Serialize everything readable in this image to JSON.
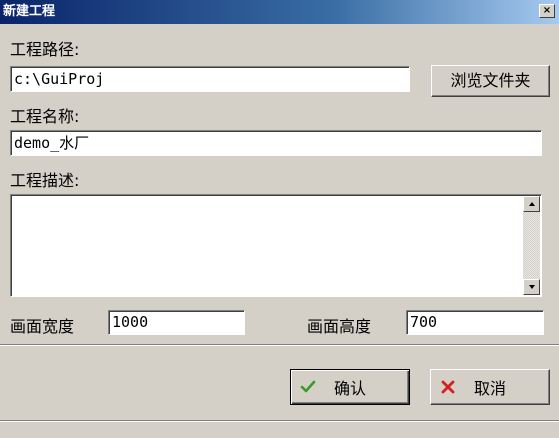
{
  "window": {
    "title": "新建工程",
    "close_glyph": "×"
  },
  "project_path": {
    "label": "工程路径:",
    "value": "c:\\GuiProj",
    "browse_label": "浏览文件夹"
  },
  "project_name": {
    "label": "工程名称:",
    "value": "demo_水厂"
  },
  "project_description": {
    "label": "工程描述:",
    "value": ""
  },
  "canvas": {
    "width_label": "画面宽度",
    "width_value": "1000",
    "height_label": "画面高度",
    "height_value": "700"
  },
  "footer": {
    "confirm_label": "确认",
    "confirm_icon": "check-icon",
    "cancel_label": "取消",
    "cancel_icon": "cross-icon"
  },
  "colors": {
    "title_start": "#0a246a",
    "title_end": "#a6caf0",
    "face": "#d4d0c8",
    "check_green": "#3a9a2a",
    "cross_red": "#d42020"
  }
}
